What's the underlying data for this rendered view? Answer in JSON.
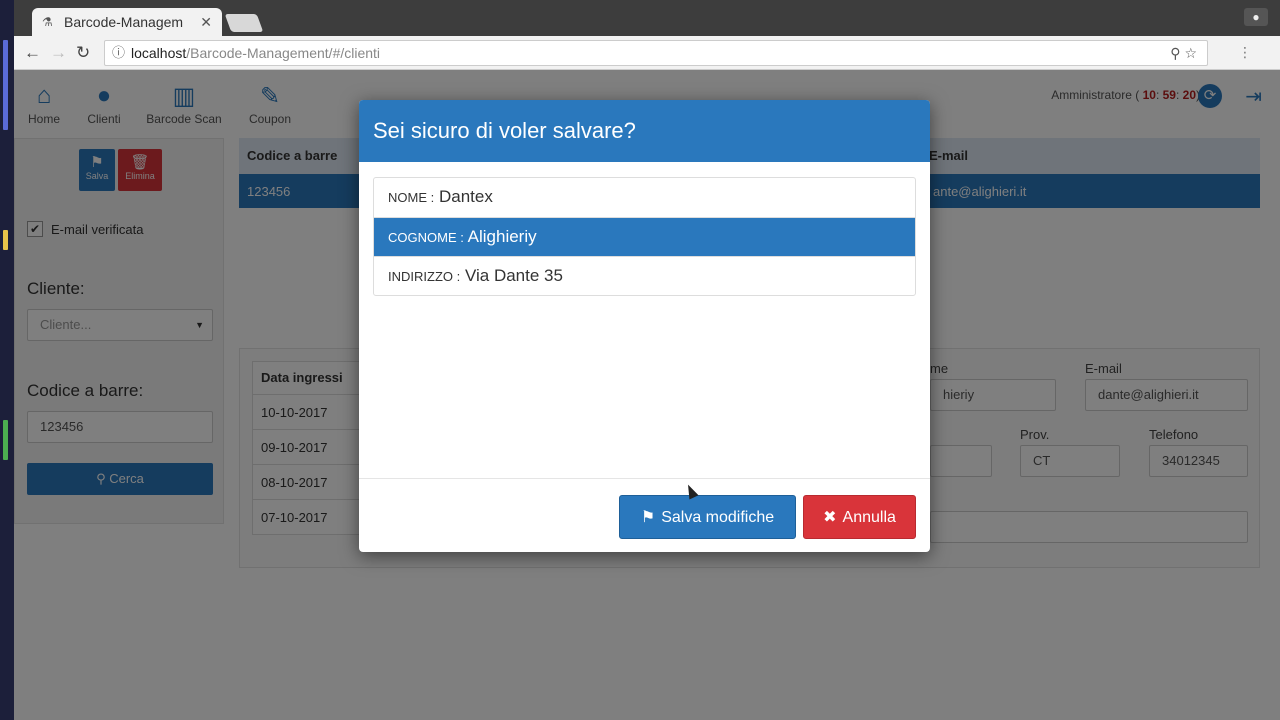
{
  "browser": {
    "tab_title": "Barcode-Managem",
    "url_host": "localhost",
    "url_path": "/Barcode-Management/#/clienti"
  },
  "nav": {
    "items": [
      {
        "label": "Home",
        "icon": "home-icon"
      },
      {
        "label": "Clienti",
        "icon": "user-icon"
      },
      {
        "label": "Barcode Scan",
        "icon": "barcode-icon"
      },
      {
        "label": "Coupon",
        "icon": "pencil-icon"
      }
    ],
    "user_prefix": "Amministratore (",
    "clock_h": "10",
    "clock_m": "59",
    "clock_s": "20",
    "user_suffix": ")"
  },
  "sidebar": {
    "save_label": "Salva",
    "delete_label": "Elimina",
    "email_verified_label": "E-mail verificata",
    "cliente_label": "Cliente:",
    "cliente_placeholder": "Cliente...",
    "barcode_label": "Codice a barre:",
    "barcode_value": "123456",
    "search_label": "Cerca"
  },
  "table": {
    "col_barcode": "Codice a barre",
    "col_email": "E-mail",
    "row_barcode": "123456",
    "row_email": "ante@alighieri.it"
  },
  "details": {
    "col_date": "Data ingressi",
    "dates": [
      "10-10-2017",
      "09-10-2017",
      "08-10-2017",
      "07-10-2017"
    ],
    "name_label": "me",
    "name_value": "hieriy",
    "email_label": "E-mail",
    "email_value": "dante@alighieri.it",
    "prov_label": "Prov.",
    "prov_value": "CT",
    "phone_label": "Telefono",
    "phone_value": "34012345"
  },
  "modal": {
    "title": "Sei sicuro di voler salvare?",
    "rows": [
      {
        "key": "NOME :",
        "value": "Dantex"
      },
      {
        "key": "COGNOME :",
        "value": "Alighieriy"
      },
      {
        "key": "INDIRIZZO :",
        "value": "Via Dante 35"
      }
    ],
    "save_button": "Salva modifiche",
    "cancel_button": "Annulla"
  },
  "colors": {
    "primary": "#2a78bd",
    "danger": "#d9343a"
  }
}
